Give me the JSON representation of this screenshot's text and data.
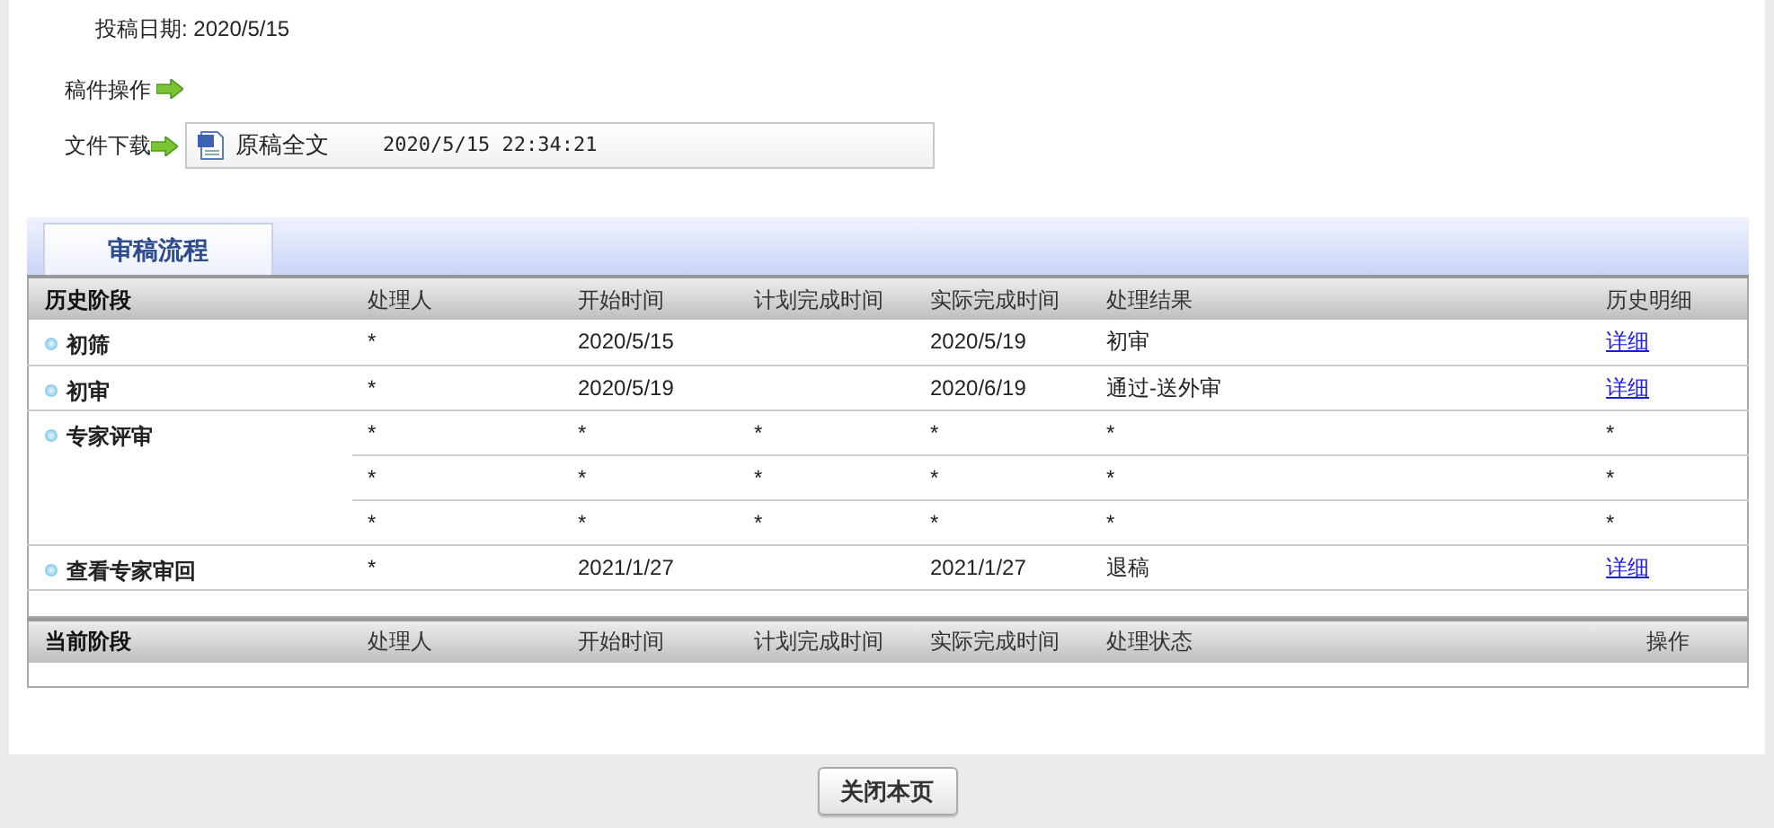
{
  "submission_date": {
    "label": "投稿日期:",
    "value": "2020/5/15"
  },
  "manuscript_actions": {
    "label": "稿件操作"
  },
  "file_download": {
    "label": "文件下载",
    "file_name": "原稿全文",
    "file_time": "2020/5/15 22:34:21"
  },
  "tabs": [
    {
      "label": "审稿流程",
      "selected": true
    }
  ],
  "history_table": {
    "columns": [
      "历史阶段",
      "处理人",
      "开始时间",
      "计划完成时间",
      "实际完成时间",
      "处理结果",
      "历史明细"
    ],
    "rows": [
      {
        "stage": "初筛",
        "entries": [
          {
            "handler": "*",
            "start": "2020/5/15",
            "actual": "2020/5/19",
            "result": "初审",
            "detail": {
              "kind": "link",
              "text": "详细"
            }
          }
        ]
      },
      {
        "stage": "初审",
        "entries": [
          {
            "handler": "*",
            "start": "2020/5/19",
            "actual": "2020/6/19",
            "result": "通过-送外审",
            "detail": {
              "kind": "link",
              "text": "详细"
            }
          }
        ]
      },
      {
        "stage": "专家评审",
        "entries": [
          {
            "handler": "*",
            "start": "*",
            "planned": "*",
            "actual": "*",
            "result": "*",
            "detail": {
              "kind": "text",
              "text": "*"
            }
          },
          {
            "handler": "*",
            "start": "*",
            "planned": "*",
            "actual": "*",
            "result": "*",
            "detail": {
              "kind": "text",
              "text": "*"
            }
          },
          {
            "handler": "*",
            "start": "*",
            "planned": "*",
            "actual": "*",
            "result": "*",
            "detail": {
              "kind": "text",
              "text": "*"
            }
          }
        ]
      },
      {
        "stage": "查看专家审回",
        "entries": [
          {
            "handler": "*",
            "start": "2021/1/27",
            "actual": "2021/1/27",
            "result": "退稿",
            "detail": {
              "kind": "link",
              "text": "详细"
            }
          }
        ]
      }
    ]
  },
  "current_table": {
    "columns": [
      "当前阶段",
      "处理人",
      "开始时间",
      "计划完成时间",
      "实际完成时间",
      "处理状态",
      "操作"
    ]
  },
  "close_button": "关闭本页"
}
